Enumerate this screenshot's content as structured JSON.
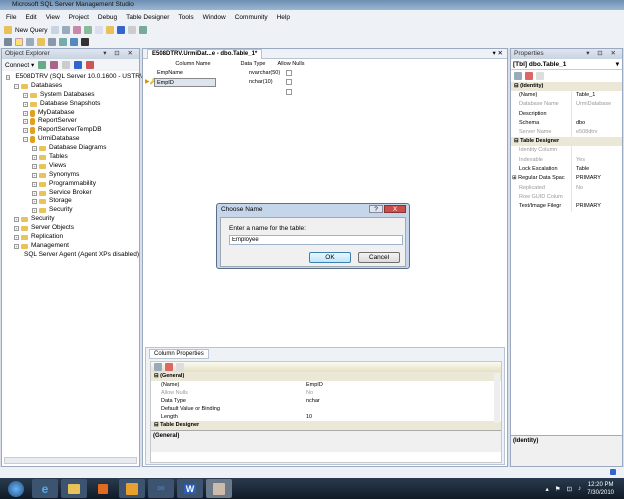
{
  "window": {
    "title": "Microsoft SQL Server Management Studio"
  },
  "menu": [
    "File",
    "Edit",
    "View",
    "Project",
    "Debug",
    "Table Designer",
    "Tools",
    "Window",
    "Community",
    "Help"
  ],
  "toolbar": {
    "new_query": "New Query"
  },
  "object_explorer": {
    "title": "Object Explorer",
    "connect": "Connect ▾",
    "server": "E508DTRV (SQL Server 10.0.1600 - USTR\\U229",
    "databases": "Databases",
    "db_items": [
      "System Databases",
      "Database Snapshots",
      "MyDatabase",
      "ReportServer",
      "ReportServerTempDB",
      "UrmiDatabase"
    ],
    "urmi_children": [
      "Database Diagrams",
      "Tables",
      "Views",
      "Synonyms",
      "Programmability",
      "Service Broker",
      "Storage",
      "Security"
    ],
    "server_items": [
      "Security",
      "Server Objects",
      "Replication",
      "Management"
    ],
    "agent": "SQL Server Agent (Agent XPs disabled)"
  },
  "designer": {
    "tab": "E508DTRV.UrmiDat...e - dbo.Table_1*",
    "headers": [
      "Column Name",
      "Data Type",
      "Allow Nulls"
    ],
    "rows": [
      {
        "name": "EmpName",
        "type": "nvarchar(50)"
      },
      {
        "name": "EmpID",
        "type": "nchar(10)"
      }
    ]
  },
  "column_properties": {
    "tab": "Column Properties",
    "section": "(General)",
    "rows": [
      {
        "k": "(Name)",
        "v": "EmpID"
      },
      {
        "k": "Allow Nulls",
        "v": "No"
      },
      {
        "k": "Data Type",
        "v": "nchar"
      },
      {
        "k": "Default Value or Binding",
        "v": ""
      },
      {
        "k": "Length",
        "v": "10"
      }
    ],
    "next_section": "Table Designer",
    "desc": "(General)"
  },
  "properties": {
    "title": "Properties",
    "object": "[Tbl] dbo.Table_1",
    "identity": "(Identity)",
    "identity_rows": [
      {
        "k": "(Name)",
        "v": "Table_1"
      },
      {
        "k": "Database Name",
        "v": "UrmiDatabase"
      },
      {
        "k": "Description",
        "v": ""
      },
      {
        "k": "Schema",
        "v": "dbo"
      },
      {
        "k": "Server Name",
        "v": "e508dtrv"
      }
    ],
    "designer": "Table Designer",
    "designer_rows": [
      {
        "k": "Identity Column",
        "v": ""
      },
      {
        "k": "Indexable",
        "v": "Yes"
      },
      {
        "k": "Lock Escalation",
        "v": "Table"
      },
      {
        "k": "Regular Data Spac",
        "v": "PRIMARY"
      },
      {
        "k": "Replicated",
        "v": "No"
      },
      {
        "k": "Row GUID Colum",
        "v": ""
      },
      {
        "k": "Text/Image Filegr",
        "v": "PRIMARY"
      }
    ],
    "desc": "(Identity)"
  },
  "dialog": {
    "title": "Choose Name",
    "label": "Enter a name for the table:",
    "value": "Employee",
    "ok": "OK",
    "cancel": "Cancel",
    "help": "?",
    "close": "X"
  },
  "clock": {
    "time": "12:20 PM",
    "date": "7/30/2010"
  }
}
